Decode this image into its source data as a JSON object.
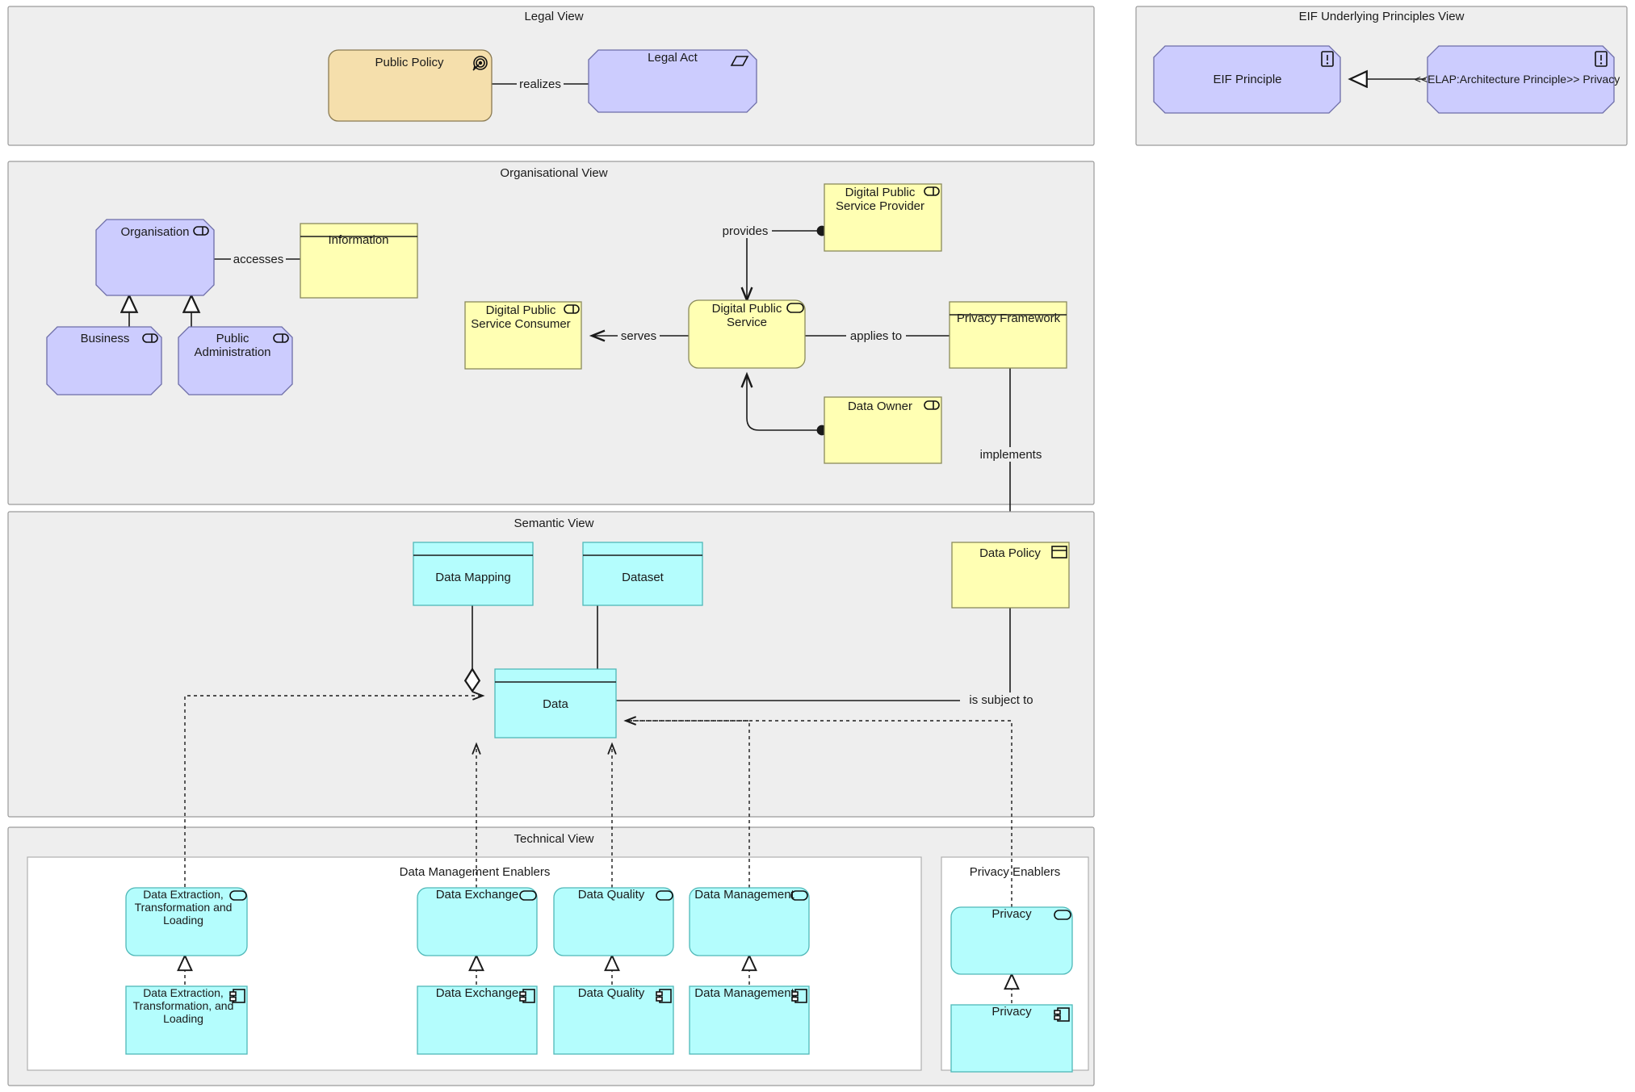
{
  "views": {
    "legal": {
      "title": "Legal View"
    },
    "eif": {
      "title": "EIF Underlying Principles View"
    },
    "organisational": {
      "title": "Organisational View"
    },
    "semantic": {
      "title": "Semantic View"
    },
    "technical": {
      "title": "Technical View"
    }
  },
  "groups": {
    "data_management_enablers": {
      "title": "Data Management Enablers"
    },
    "privacy_enablers": {
      "title": "Privacy Enablers"
    }
  },
  "nodes": {
    "public_policy": {
      "label": "Public Policy",
      "icon": "goal-icon",
      "fill": "#f5dfac"
    },
    "legal_act": {
      "label": "Legal Act",
      "icon": "business-object-parallelogram-icon",
      "fill": "#ccccfe"
    },
    "eif_principle": {
      "label": "EIF Principle",
      "icon": "principle-icon",
      "fill": "#ccccfe"
    },
    "elap_privacy": {
      "label": "<<ELAP:Architecture Principle>> Privacy",
      "icon": "principle-icon",
      "fill": "#ccccfe"
    },
    "organisation": {
      "label": "Organisation",
      "icon": "business-role-icon",
      "fill": "#ccccfe"
    },
    "information": {
      "label": "Information",
      "icon": "none",
      "fill": "#ffffb3"
    },
    "business": {
      "label": "Business",
      "icon": "business-role-icon",
      "fill": "#ccccfe"
    },
    "public_administration": {
      "label": "Public Administration",
      "icon": "business-role-icon",
      "fill": "#ccccfe"
    },
    "dps_provider": {
      "label": "Digital Public Service Provider",
      "icon": "business-role-icon",
      "fill": "#ffffb3"
    },
    "dps_consumer": {
      "label": "Digital Public Service Consumer",
      "icon": "business-role-icon",
      "fill": "#ffffb3"
    },
    "digital_public_service": {
      "label": "Digital Public Service",
      "icon": "service-icon",
      "fill": "#ffffb3"
    },
    "privacy_framework": {
      "label": "Privacy Framework",
      "icon": "none",
      "fill": "#ffffb3"
    },
    "data_owner": {
      "label": "Data Owner",
      "icon": "business-role-icon",
      "fill": "#ffffb3"
    },
    "data_mapping": {
      "label": "Data Mapping",
      "icon": "none",
      "fill": "#b4fdfd"
    },
    "dataset": {
      "label": "Dataset",
      "icon": "none",
      "fill": "#b4fdfd"
    },
    "data": {
      "label": "Data",
      "icon": "none",
      "fill": "#b4fdfd"
    },
    "data_policy": {
      "label": "Data Policy",
      "icon": "business-object-icon",
      "fill": "#ffffb3"
    },
    "etl_service": {
      "label": "Data Extraction, Transformation and Loading",
      "icon": "service-icon",
      "fill": "#b4fdfd"
    },
    "etl_component": {
      "label": "Data Extraction, Transformation, and Loading",
      "icon": "component-icon",
      "fill": "#b4fdfd"
    },
    "data_exchange_service": {
      "label": "Data Exchange",
      "icon": "service-icon",
      "fill": "#b4fdfd"
    },
    "data_exchange_component": {
      "label": "Data Exchange",
      "icon": "component-icon",
      "fill": "#b4fdfd"
    },
    "data_quality_service": {
      "label": "Data Quality",
      "icon": "service-icon",
      "fill": "#b4fdfd"
    },
    "data_quality_component": {
      "label": "Data Quality",
      "icon": "component-icon",
      "fill": "#b4fdfd"
    },
    "data_management_service": {
      "label": "Data Management",
      "icon": "service-icon",
      "fill": "#b4fdfd"
    },
    "data_management_component": {
      "label": "Data Management",
      "icon": "component-icon",
      "fill": "#b4fdfd"
    },
    "privacy_service": {
      "label": "Privacy",
      "icon": "service-icon",
      "fill": "#b4fdfd"
    },
    "privacy_component": {
      "label": "Privacy",
      "icon": "component-icon",
      "fill": "#b4fdfd"
    }
  },
  "edges": {
    "realizes": {
      "label": "realizes"
    },
    "accesses": {
      "label": "accesses"
    },
    "provides": {
      "label": "provides"
    },
    "serves": {
      "label": "serves"
    },
    "applies_to": {
      "label": "applies to"
    },
    "implements": {
      "label": "implements"
    },
    "is_subject_to": {
      "label": "is subject to"
    }
  },
  "colors": {
    "canvas": "#ffffff",
    "view_fill": "#eeeeee",
    "view_stroke": "#9a9a9a",
    "group_fill": "#ffffff",
    "group_stroke": "#b0b0b0",
    "motivation_purple": "#ccccfe",
    "goal_orange": "#f5dfac",
    "business_yellow": "#ffffb3",
    "data_cyan": "#b4fdfd",
    "line": "#1a1a1a",
    "text": "#1a1a1a"
  }
}
